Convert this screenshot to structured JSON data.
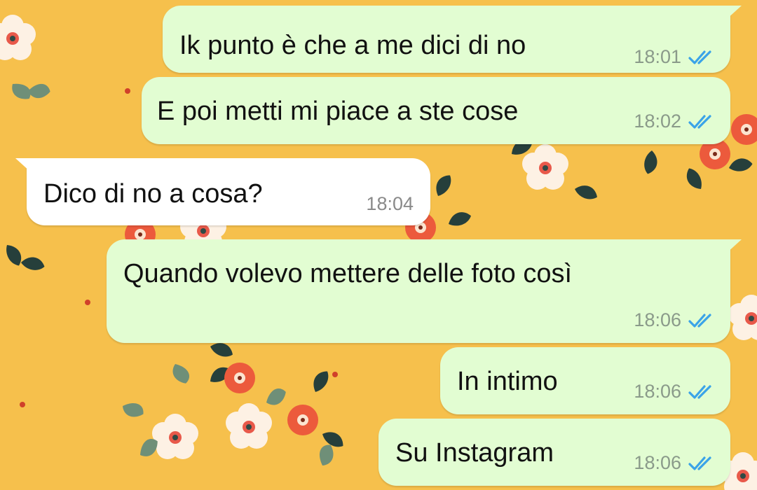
{
  "colors": {
    "wallpaper": "#f6c04c",
    "outgoing_bubble": "#e2fdd2",
    "incoming_bubble": "#ffffff",
    "read_ticks": "#3aa3e8",
    "timestamp": "#8a9a8a"
  },
  "messages": [
    {
      "direction": "out",
      "text": "Ik punto è che a me dici di no",
      "time": "18:01",
      "status": "read",
      "status_icon": "double-check-icon"
    },
    {
      "direction": "out",
      "text": "E poi metti mi piace a ste cose",
      "time": "18:02",
      "status": "read",
      "status_icon": "double-check-icon"
    },
    {
      "direction": "in",
      "text": "Dico di no a cosa?",
      "time": "18:04"
    },
    {
      "direction": "out",
      "text": "Quando volevo mettere delle foto così",
      "time": "18:06",
      "status": "read",
      "status_icon": "double-check-icon"
    },
    {
      "direction": "out",
      "text": "In intimo",
      "time": "18:06",
      "status": "read",
      "status_icon": "double-check-icon"
    },
    {
      "direction": "out",
      "text": "Su Instagram",
      "time": "18:06",
      "status": "read",
      "status_icon": "double-check-icon"
    }
  ]
}
